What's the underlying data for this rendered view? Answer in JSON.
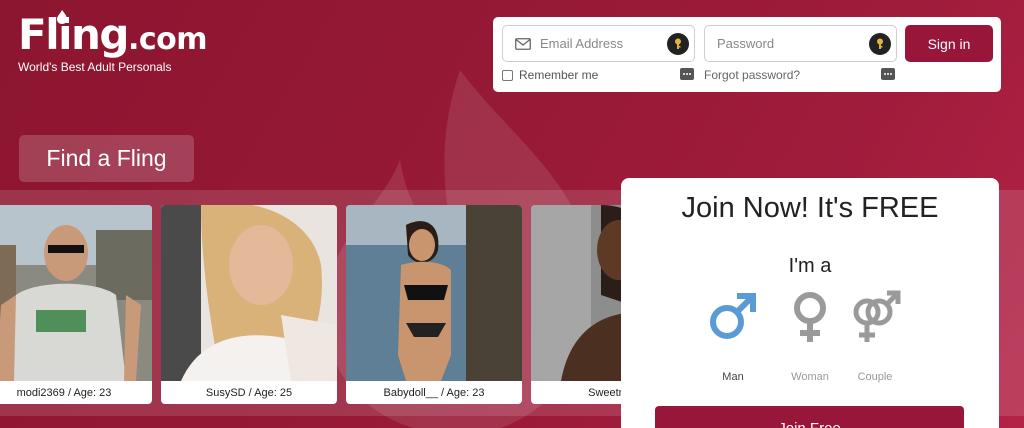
{
  "brand": {
    "logo_main": "Fling",
    "logo_suffix": ".com",
    "tagline": "World's Best Adult Personals"
  },
  "login": {
    "email_placeholder": "Email Address",
    "password_placeholder": "Password",
    "signin_label": "Sign in",
    "remember_label": "Remember me",
    "forgot_label": "Forgot password?"
  },
  "find_label": "Find a Fling",
  "profiles": [
    {
      "caption": "modi2369 / Age: 23"
    },
    {
      "caption": "SusySD / Age: 25"
    },
    {
      "caption": "Babydoll__ / Age: 23"
    },
    {
      "caption": "SweetnSash"
    }
  ],
  "join": {
    "title": "Join Now! It's FREE",
    "prompt": "I'm a",
    "options": [
      {
        "label": "Man",
        "icon": "male-symbol-icon",
        "color": "#5b9bd5"
      },
      {
        "label": "Woman",
        "icon": "female-symbol-icon",
        "color": "#9a9a9a"
      },
      {
        "label": "Couple",
        "icon": "couple-symbol-icon",
        "color": "#9a9a9a"
      }
    ],
    "button_label": "Join Free"
  },
  "colors": {
    "brand": "#97163a",
    "background": "#961935",
    "male": "#5b9bd5"
  }
}
